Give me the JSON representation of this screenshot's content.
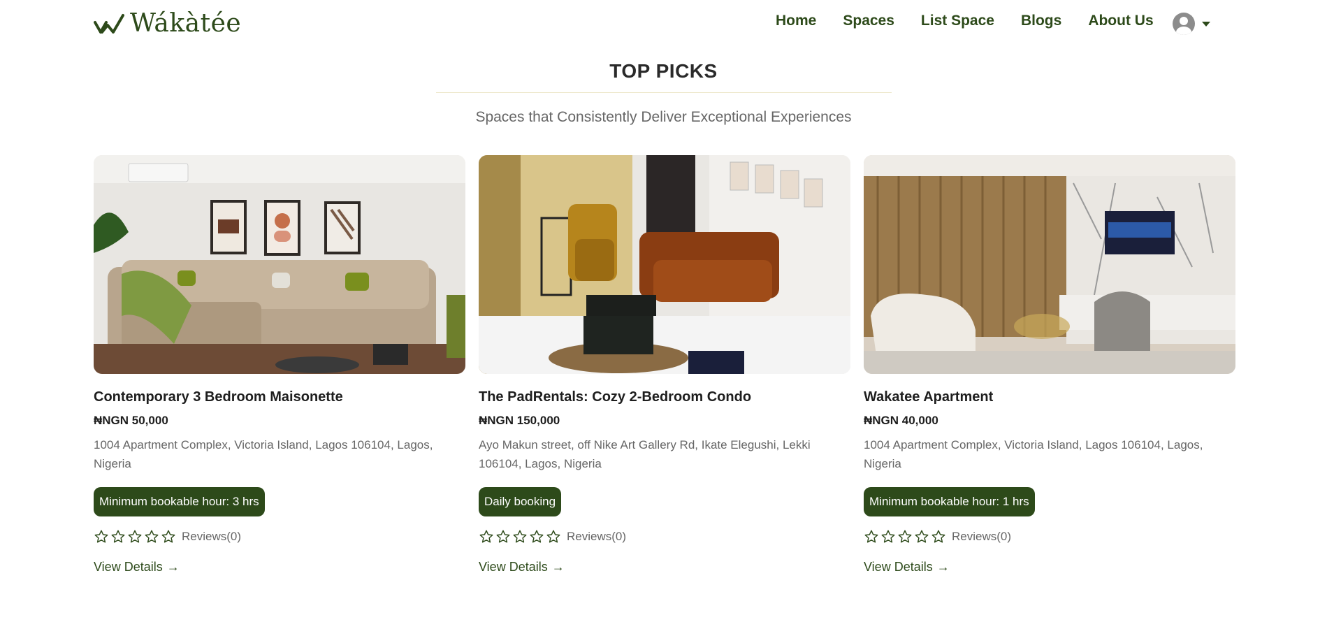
{
  "brand": {
    "name": "Wákàtée",
    "accent": "#2d4a1a"
  },
  "nav": {
    "items": [
      "Home",
      "Spaces",
      "List Space",
      "Blogs",
      "About Us"
    ]
  },
  "section": {
    "title": "TOP PICKS",
    "subtitle": "Spaces that Consistently Deliver Exceptional Experiences"
  },
  "cards": [
    {
      "title": "Contemporary 3 Bedroom Maisonette",
      "price": "₦NGN 50,000",
      "address": "1004 Apartment Complex, Victoria Island, Lagos 106104, Lagos, Nigeria",
      "badge": "Minimum bookable hour: 3 hrs",
      "reviews": "Reviews(0)",
      "rating": 0,
      "cta": "View Details"
    },
    {
      "title": "The PadRentals: Cozy 2-Bedroom Condo",
      "price": "₦NGN 150,000",
      "address": "Ayo Makun street, off Nike Art Gallery Rd, Ikate Elegushi, Lekki 106104, Lagos, Nigeria",
      "badge": "Daily booking",
      "reviews": "Reviews(0)",
      "rating": 0,
      "cta": "View Details"
    },
    {
      "title": "Wakatee Apartment",
      "price": "₦NGN 40,000",
      "address": "1004 Apartment Complex, Victoria Island, Lagos 106104, Lagos, Nigeria",
      "badge": "Minimum bookable hour: 1 hrs",
      "reviews": "Reviews(0)",
      "rating": 0,
      "cta": "View Details"
    }
  ]
}
